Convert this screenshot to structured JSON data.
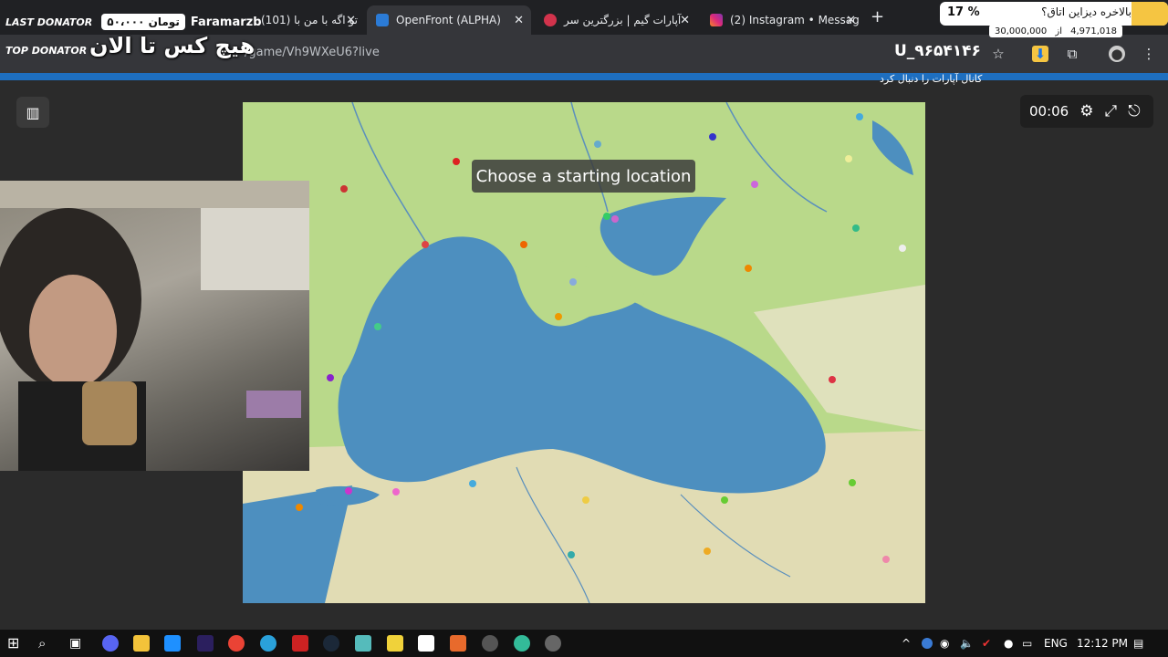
{
  "browser": {
    "tabs": [
      {
        "label": "(101) تو اگه با من با",
        "active": false
      },
      {
        "label": "OpenFront (ALPHA)",
        "active": true
      },
      {
        "label": "آپارات گیم | بزرگترین سر",
        "active": false
      },
      {
        "label": "(2) Instagram • Messag",
        "active": false
      }
    ],
    "url": "/game/Vh9WXeU6?live",
    "profile_label": "U_۹۶۵۴۱۴۶"
  },
  "overlay": {
    "last_donator_label": "LAST DONATOR",
    "last_donator_amount": "۵۰،۰۰۰ تومان",
    "last_donator_name": "Faramarzb",
    "top_donator_label": "TOP DONATOR",
    "top_donator_text": "هیچ کس تا الان",
    "goal_title": "بالاخره دیزاین اتاق؟",
    "goal_percent": "17 %",
    "goal_target": "30,000,000",
    "goal_from": "از",
    "goal_current": "4,971,018",
    "subtitle": "کانال آپارات را دنبال کرد"
  },
  "game": {
    "banner": "Choose a starting location",
    "timer": "00:06"
  },
  "taskbar": {
    "lang": "ENG",
    "time": "12:12 PM"
  },
  "colors": {
    "sea": "#4d8fbf",
    "land": "#b9d98a",
    "accent": "#1e6fc0"
  }
}
